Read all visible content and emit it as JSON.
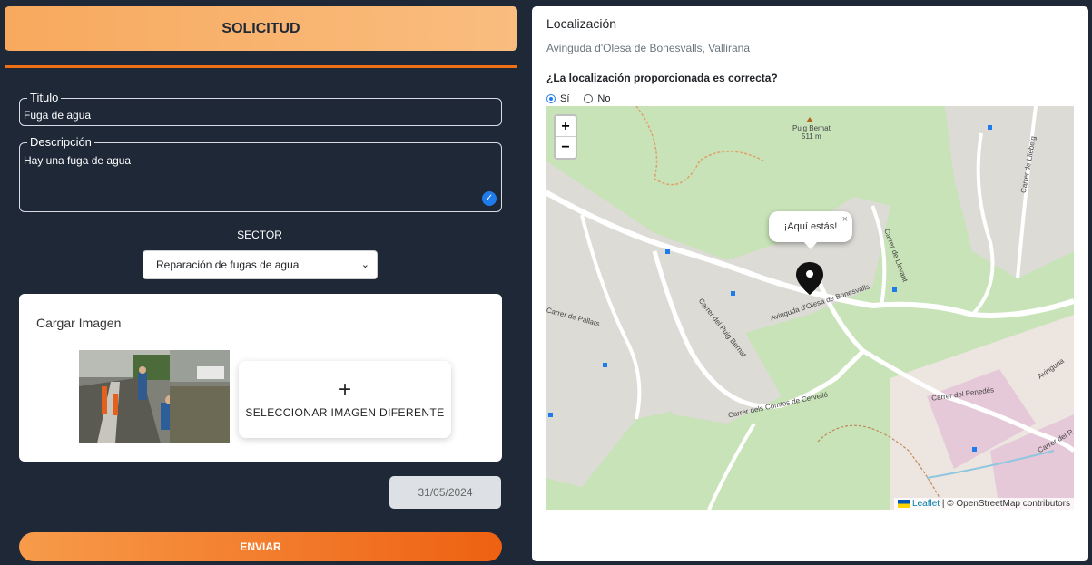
{
  "form": {
    "header_title": "SOLICITUD",
    "title_legend": "Titulo",
    "title_value": "Fuga de agua",
    "desc_legend": "Descripción",
    "desc_value": "Hay una fuga de agua",
    "sector_label": "SECTOR",
    "sector_selected": "Reparación de fugas de agua",
    "upload_title": "Cargar Imagen",
    "select_image_plus": "+",
    "select_image_label": "SELECCIONAR IMAGEN DIFERENTE",
    "date_value": "31/05/2024",
    "submit_label": "ENVIAR"
  },
  "location": {
    "title": "Localización",
    "address": "Avinguda d'Olesa de Bonesvalls, Vallirana",
    "question": "¿La localización proporcionada es correcta?",
    "option_yes": "Sí",
    "option_no": "No",
    "selected": "Sí"
  },
  "map": {
    "zoom_in": "+",
    "zoom_out": "−",
    "popup_text": "¡Aquí estás!",
    "popup_close": "×",
    "attribution_link": "Leaflet",
    "attribution_text": " | © OpenStreetMap contributors",
    "labels": [
      "Puig Bernat",
      "511 m",
      "Avinguda d'Olesa de Bonesvalls",
      "Carrer del Puig Bernat",
      "Carrer dels Comtes de Cervelló",
      "Carrer del Penedès",
      "Carrer de Lliebeig",
      "Carrer de Llevant",
      "Carrer de Pallars",
      "Avinguda",
      "Carrer del R"
    ]
  },
  "colors": {
    "background": "#1e2837",
    "accent": "#ef6f14",
    "primary_blue": "#1f7bea"
  }
}
